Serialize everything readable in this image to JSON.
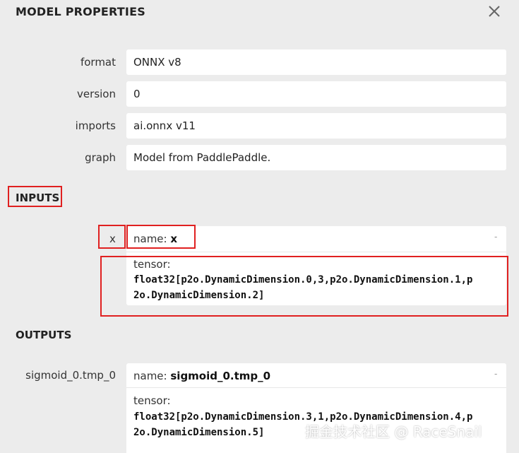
{
  "panel": {
    "title": "MODEL PROPERTIES"
  },
  "properties": [
    {
      "label": "format",
      "value": "ONNX v8"
    },
    {
      "label": "version",
      "value": "0"
    },
    {
      "label": "imports",
      "value": "ai.onnx v11"
    },
    {
      "label": "graph",
      "value": "Model from PaddlePaddle."
    }
  ],
  "inputs": {
    "title": "INPUTS",
    "items": [
      {
        "label": "x",
        "name_prefix": "name: ",
        "name": "x",
        "expander": "-",
        "tensor_label": "tensor:",
        "tensor_line1": "float32[p2o.DynamicDimension.0,3,p2o.DynamicDimension.1,p",
        "tensor_line2": "2o.DynamicDimension.2]"
      }
    ]
  },
  "outputs": {
    "title": "OUTPUTS",
    "items": [
      {
        "label": "sigmoid_0.tmp_0",
        "name_prefix": "name: ",
        "name": "sigmoid_0.tmp_0",
        "expander": "-",
        "tensor_label": "tensor:",
        "tensor_line1": "float32[p2o.DynamicDimension.3,1,p2o.DynamicDimension.4,p",
        "tensor_line2": "2o.DynamicDimension.5]"
      }
    ]
  },
  "watermark": "掘金技术社区 @ RaceSnail",
  "colors": {
    "background": "#ececec",
    "field": "#ffffff",
    "highlight": "#e02020"
  }
}
